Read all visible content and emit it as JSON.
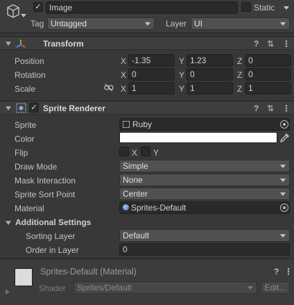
{
  "gameobject": {
    "name": "Image",
    "active": true,
    "static_label": "Static",
    "tag_label": "Tag",
    "tag_value": "Untagged",
    "layer_label": "Layer",
    "layer_value": "UI"
  },
  "transform": {
    "title": "Transform",
    "rows": [
      {
        "label": "Position",
        "x": "-1.35",
        "y": "1.23",
        "z": "0"
      },
      {
        "label": "Rotation",
        "x": "0",
        "y": "0",
        "z": "0"
      },
      {
        "label": "Scale",
        "x": "1",
        "y": "1",
        "z": "1"
      }
    ],
    "axis": {
      "x": "X",
      "y": "Y",
      "z": "Z"
    }
  },
  "sprite_renderer": {
    "title": "Sprite Renderer",
    "enabled": true,
    "sprite_label": "Sprite",
    "sprite_value": "Ruby",
    "color_label": "Color",
    "color_value": "#ffffff",
    "flip_label": "Flip",
    "flip_x": "X",
    "flip_y": "Y",
    "draw_mode_label": "Draw Mode",
    "draw_mode_value": "Simple",
    "mask_label": "Mask Interaction",
    "mask_value": "None",
    "sort_point_label": "Sprite Sort Point",
    "sort_point_value": "Center",
    "material_label": "Material",
    "material_value": "Sprites-Default",
    "additional_label": "Additional Settings",
    "sorting_layer_label": "Sorting Layer",
    "sorting_layer_value": "Default",
    "order_label": "Order in Layer",
    "order_value": "0"
  },
  "material": {
    "title": "Sprites-Default (Material)",
    "shader_label": "Shader",
    "shader_value": "Sprites/Default",
    "edit_label": "Edit..."
  },
  "icons": {
    "gameobject": "cube-icon",
    "transform": "transform-axes-icon",
    "sprite_renderer": "sprite-renderer-icon",
    "help": "help-icon",
    "presets": "presets-icon",
    "menu": "kebab-menu-icon",
    "link": "constrain-proportions-icon",
    "picker": "object-picker-icon",
    "eyedropper": "eyedropper-icon"
  }
}
